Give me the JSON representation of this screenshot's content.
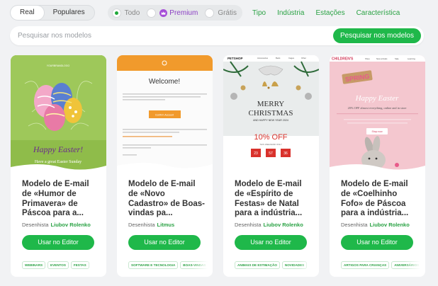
{
  "toggle": {
    "options": [
      "Real",
      "Populares"
    ],
    "active_index": 0
  },
  "filters": {
    "todo": "Todo",
    "premium": "Premium",
    "gratis": "Grátis",
    "selected": "Todo"
  },
  "nav": [
    "Tipo",
    "Indústria",
    "Estações",
    "Característica"
  ],
  "search": {
    "placeholder": "Pesquisar nos modelos",
    "button": "Pesquisar nos modelos"
  },
  "author_label": "Desenhista",
  "editor_button": "Usar no Editor",
  "cards": [
    {
      "title": "Modelo de E-mail de «Humor de Primavera» de Páscoa para a...",
      "author": "Liubov Rolenko",
      "tags": [
        "WEBINARS",
        "EVENTOS",
        "FESTAS"
      ],
      "preview": {
        "brand": "YOURBRANDLOGO",
        "headline": "Happy Easter!",
        "subline": "Have a great Easter Sunday"
      }
    },
    {
      "title": "Modelo de E-mail de «Novo Cadastro» de Boas-vindas pa...",
      "author": "Litmus",
      "tags": [
        "SOFTWARE E TECNOLOGIA",
        "BOAS-VINDAS"
      ],
      "preview": {
        "headline": "Welcome!",
        "button": "Confirm Account"
      }
    },
    {
      "title": "Modelo de E-mail de «Espírito de Festas» de Natal para a indústria...",
      "author": "Liubov Rolenko",
      "tags": [
        "ANIMAIS DE ESTIMAÇÃO",
        "NOVIDADES"
      ],
      "preview": {
        "brand": "PETSHOP",
        "menu": [
          "Accessories",
          "Beds",
          "Cages",
          "Other"
        ],
        "headline1": "MERRY",
        "headline2": "CHRISTMAS",
        "subline": "AND HAPPY NEW YEAR 2024",
        "offer": "10% OFF",
        "offer_sub": "THIS WEEKEND ONLY",
        "countdown": [
          "23",
          "57",
          "36"
        ]
      }
    },
    {
      "title": "Modelo de E-mail de «Coelhinho Fofo» de Páscoa para a indústria...",
      "author": "Liubov Rolenko",
      "tags": [
        "ARTIGOS PARA CRIANÇAS",
        "ANIVERSÁRIOS"
      ],
      "preview": {
        "brand": "CHILDREN'S",
        "menu": [
          "Shop",
          "New arrivals",
          "Sale",
          "Learning"
        ],
        "sign": "SPRING",
        "headline": "Happy Easter",
        "subline": "20% OFF almost everything, online and in store",
        "button": "Shop now"
      }
    }
  ],
  "colors": {
    "accent": "#1fb84a",
    "link": "#2aa244",
    "premium": "#a64fd8"
  }
}
